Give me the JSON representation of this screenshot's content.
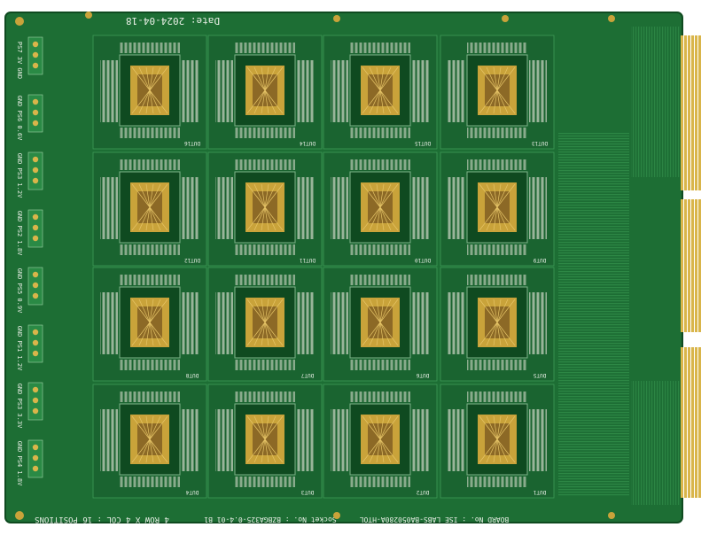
{
  "board": {
    "date_label": "Date: 2024-04-18",
    "bottom_silkscreen": "4 ROW X 4 COL : 16 POSITIONS",
    "socket_label": "Socket No. : BZBGA325-0.4-01 B1",
    "board_label": "BOARD No. : ISE LABS-BA050280A-HTOL",
    "left_rails": [
      "PS7 3V GND",
      "GND PS6 0.6V",
      "GND PS3 1.2V",
      "GND PS2 1.8V",
      "GND PS5 0.9V",
      "GND PS1 1.2V",
      "GND PS3 3.3V",
      "GND PS4 1.8V"
    ],
    "dut_labels": [
      "DUT16",
      "DUT14",
      "DUT15",
      "DUT13",
      "DUT12",
      "DUT11",
      "DUT10",
      "DUT9",
      "DUT8",
      "DUT7",
      "DUT6",
      "DUT5",
      "DUT4",
      "DUT3",
      "DUT2",
      "DUT1"
    ],
    "colors": {
      "board_green": "#1d6e34",
      "board_dark": "#0f4a20",
      "copper_gold": "#c9a33a",
      "silkscreen": "#e9efe6"
    }
  }
}
